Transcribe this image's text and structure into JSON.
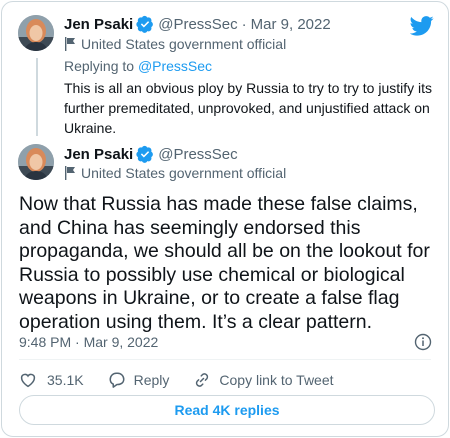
{
  "colors": {
    "accent": "#1d9bf0",
    "muted": "#536471",
    "text": "#0f1419",
    "border": "#cfd9de"
  },
  "parent_tweet": {
    "author": {
      "display_name": "Jen Psaki",
      "handle": "@PressSec",
      "verified": true,
      "avatar_icon": "avatar-photo"
    },
    "separator": "·",
    "date": "Mar 9, 2022",
    "account_label": "United States government official",
    "label_icon": "flag-icon",
    "replying_prefix": "Replying to",
    "replying_mention": "@PressSec",
    "text": "This is all an obvious ploy by Russia to try to try to justify its further premeditated, unprovoked, and unjustified attack on Ukraine."
  },
  "main_tweet": {
    "author": {
      "display_name": "Jen Psaki",
      "handle": "@PressSec",
      "verified": true,
      "avatar_icon": "avatar-photo"
    },
    "account_label": "United States government official",
    "label_icon": "flag-icon",
    "text": "Now that Russia has made these false claims, and China has seemingly endorsed this propaganda, we should all be on the lookout for Russia to possibly use chemical or biological weapons in Ukraine, or to create a false flag operation using them. It’s a clear pattern.",
    "timestamp": "9:48 PM · Mar 9, 2022",
    "info_icon": "info-icon"
  },
  "actions": {
    "like_count": "35.1K",
    "like_icon": "heart-icon",
    "reply_label": "Reply",
    "reply_icon": "speech-bubble-icon",
    "copy_link_label": "Copy link to Tweet",
    "copy_link_icon": "link-icon"
  },
  "read_replies_label": "Read 4K replies",
  "brand_icon": "twitter-bird-icon"
}
